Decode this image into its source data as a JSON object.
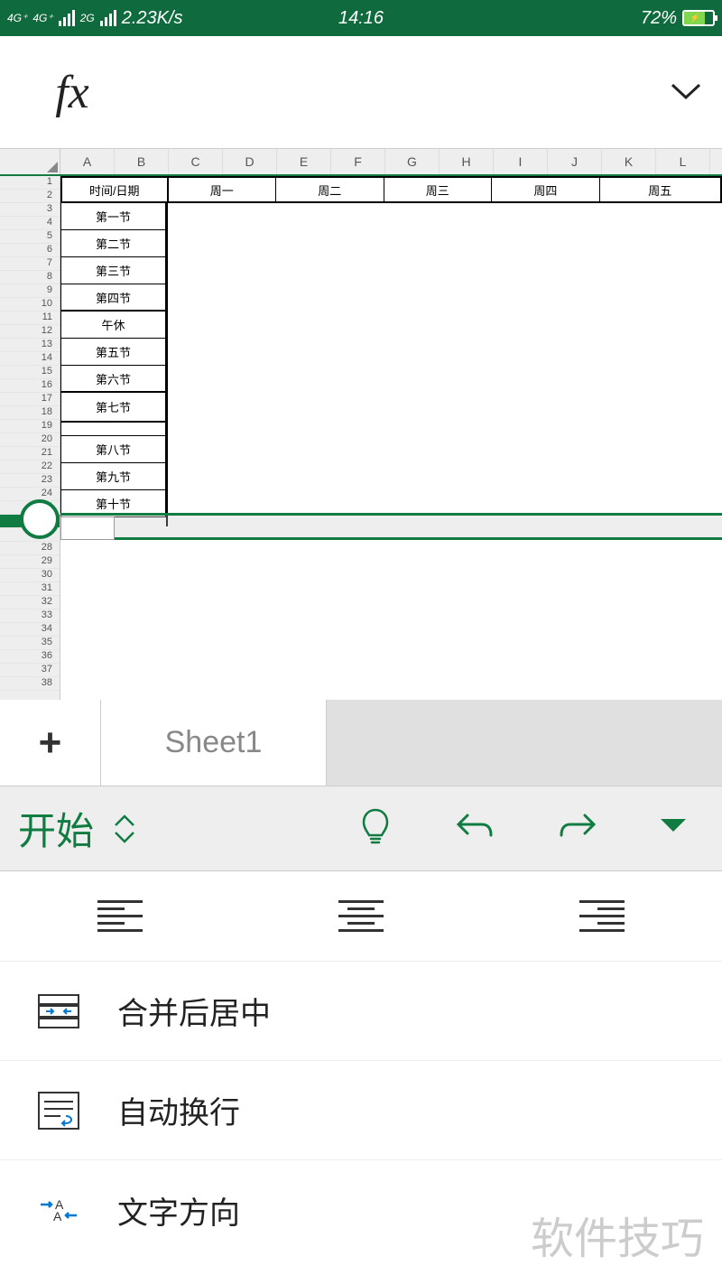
{
  "status": {
    "network1": "4G⁺",
    "network2": "4G⁺",
    "network3": "2G",
    "speed": "2.23K/s",
    "time": "14:16",
    "battery": "72%"
  },
  "formula": {
    "fx": "fx"
  },
  "columns": [
    "A",
    "B",
    "C",
    "D",
    "E",
    "F",
    "G",
    "H",
    "I",
    "J",
    "K",
    "L"
  ],
  "rows_start": 1,
  "rows_end": 38,
  "selected_row": 26,
  "schedule": {
    "header": "时间/日期",
    "days": [
      "周一",
      "周二",
      "周三",
      "周四",
      "周五"
    ],
    "periods": [
      "第一节",
      "第二节",
      "第三节",
      "第四节",
      "午休",
      "第五节",
      "第六节",
      "第七节",
      "",
      "第八节",
      "第九节",
      "第十节"
    ]
  },
  "sheet": {
    "tab": "Sheet1"
  },
  "ribbon": {
    "tab": "开始"
  },
  "menu": {
    "merge": "合并后居中",
    "wrap": "自动换行",
    "direction": "文字方向"
  },
  "watermark": "软件技巧"
}
